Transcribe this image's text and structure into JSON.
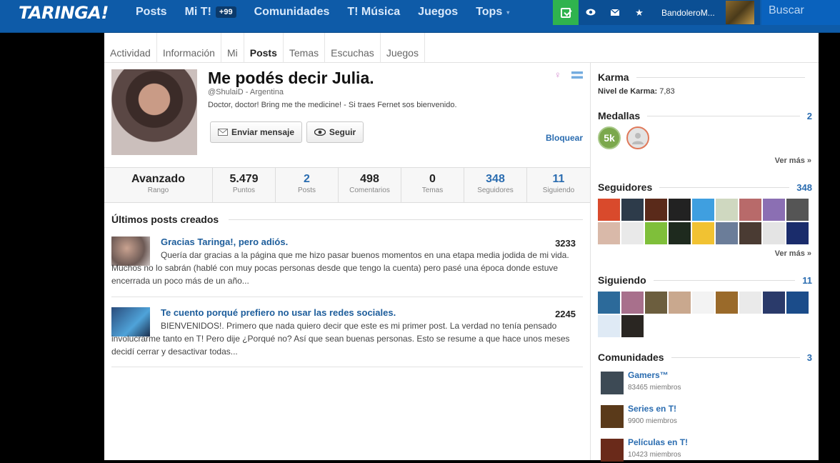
{
  "topbar": {
    "logo": "TARINGA!",
    "nav": [
      {
        "label": "Posts"
      },
      {
        "label": "Mi T!",
        "badge": "+99"
      },
      {
        "label": "Comunidades"
      },
      {
        "label": "T! Música"
      },
      {
        "label": "Juegos"
      },
      {
        "label": "Tops",
        "caret": "▾"
      }
    ],
    "username": "BandoleroM...",
    "search_placeholder": "Buscar"
  },
  "tabs": [
    "Actividad",
    "Información",
    "Mi",
    "Posts",
    "Temas",
    "Escuchas",
    "Juegos"
  ],
  "profile": {
    "name": "Me podés decir Julia.",
    "handle": "@ShulaiD - Argentina",
    "bio": "Doctor, doctor! Bring me the medicine! - Si traes Fernet sos bienvenido.",
    "send_message": "Enviar mensaje",
    "follow": "Seguir",
    "block": "Bloquear"
  },
  "stats": [
    {
      "value": "Avanzado",
      "label": "Rango"
    },
    {
      "value": "5.479",
      "label": "Puntos"
    },
    {
      "value": "2",
      "label": "Posts"
    },
    {
      "value": "498",
      "label": "Comentarios"
    },
    {
      "value": "0",
      "label": "Temas"
    },
    {
      "value": "348",
      "label": "Seguidores"
    },
    {
      "value": "11",
      "label": "Siguiendo"
    }
  ],
  "posts_section": {
    "title": "Últimos posts creados",
    "posts": [
      {
        "title": "Gracias Taringa!, pero adiós.",
        "count": "3233",
        "text": "Quería dar gracias a la página que me hizo pasar buenos momentos en una etapa media jodida de mi vida. Muchos no lo sabrán (hablé con muy pocas personas desde que tengo la cuenta) pero pasé una época donde estuve encerrada un poco más de un año..."
      },
      {
        "title": "Te cuento porqué prefiero no usar las redes sociales.",
        "count": "2245",
        "text": "BIENVENIDOS!. Primero que nada quiero decir que este es mi primer post. La verdad no tenía pensado involucrarme tanto en T! Pero dije ¿Porqué no? Así que sean buenas personas. Esto se resume a que hace unos meses decidí cerrar y desactivar todas..."
      }
    ]
  },
  "sidebar": {
    "karma": {
      "title": "Karma",
      "label": "Nivel de Karma:",
      "value": "7,83"
    },
    "medals": {
      "title": "Medallas",
      "count": "2",
      "medal_1": "5k",
      "more": "Ver más »"
    },
    "followers": {
      "title": "Seguidores",
      "count": "348",
      "more": "Ver más »"
    },
    "following": {
      "title": "Siguiendo",
      "count": "11"
    },
    "communities": {
      "title": "Comunidades",
      "count": "3",
      "items": [
        {
          "name": "Gamers™",
          "members": "83465 miembros"
        },
        {
          "name": "Series en T!",
          "members": "9900 miembros"
        },
        {
          "name": "Películas en T!",
          "members": "10423 miembros"
        }
      ]
    }
  },
  "colors": {
    "brand": "#0e5ba8",
    "link": "#2a6cb0",
    "green": "#2fb34e"
  }
}
